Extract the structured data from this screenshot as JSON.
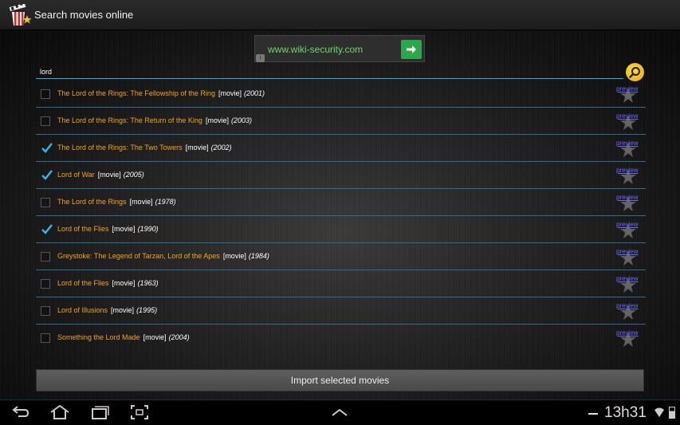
{
  "app": {
    "title": "Search movies online",
    "icon": "popcorn-clapperboard-icon"
  },
  "ad": {
    "text": "www.wiki-security.com",
    "info_icon": "info-icon",
    "go_icon": "arrow-right-icon",
    "go_color": "#2aa84a",
    "text_color": "#6fd36f"
  },
  "search": {
    "value": "lord",
    "placeholder": "",
    "button_icon": "search-icon",
    "accent": "#3aa6d9"
  },
  "results": [
    {
      "title": "The Lord of the Rings: The Fellowship of the Ring",
      "kind": "[movie]",
      "year": "(2001)",
      "checked": false,
      "preview_label": "preview"
    },
    {
      "title": "The Lord of the Rings: The Return of the King",
      "kind": "[movie]",
      "year": "(2003)",
      "checked": false,
      "preview_label": "preview"
    },
    {
      "title": "The Lord of the Rings: The Two Towers",
      "kind": "[movie]",
      "year": "(2002)",
      "checked": true,
      "preview_label": "preview"
    },
    {
      "title": "Lord of War",
      "kind": "[movie]",
      "year": "(2005)",
      "checked": true,
      "preview_label": "preview"
    },
    {
      "title": "The Lord of the Rings",
      "kind": "[movie]",
      "year": "(1978)",
      "checked": false,
      "preview_label": "preview"
    },
    {
      "title": "Lord of the Flies",
      "kind": "[movie]",
      "year": "(1990)",
      "checked": true,
      "preview_label": "preview"
    },
    {
      "title": "Greystoke: The Legend of Tarzan, Lord of the Apes",
      "kind": "[movie]",
      "year": "(1984)",
      "checked": false,
      "preview_label": "preview"
    },
    {
      "title": "Lord of the Flies",
      "kind": "[movie]",
      "year": "(1963)",
      "checked": false,
      "preview_label": "preview"
    },
    {
      "title": "Lord of Illusions",
      "kind": "[movie]",
      "year": "(1995)",
      "checked": false,
      "preview_label": "preview"
    },
    {
      "title": "Something the Lord Made",
      "kind": "[movie]",
      "year": "(2004)",
      "checked": false,
      "preview_label": "preview"
    }
  ],
  "import_button": {
    "label": "Import selected movies"
  },
  "system_bar": {
    "back_icon": "back-icon",
    "home_icon": "home-icon",
    "recent_icon": "recent-apps-icon",
    "screenshot_icon": "screenshot-icon",
    "expand_icon": "chevron-up-icon",
    "time": "13h31",
    "wifi_icon": "wifi-icon",
    "battery_icon": "battery-icon"
  },
  "colors": {
    "title_orange": "#f0a424",
    "check_blue": "#33b5e5",
    "divider": "#2a6f8f",
    "preview_link": "#6b6bff"
  }
}
